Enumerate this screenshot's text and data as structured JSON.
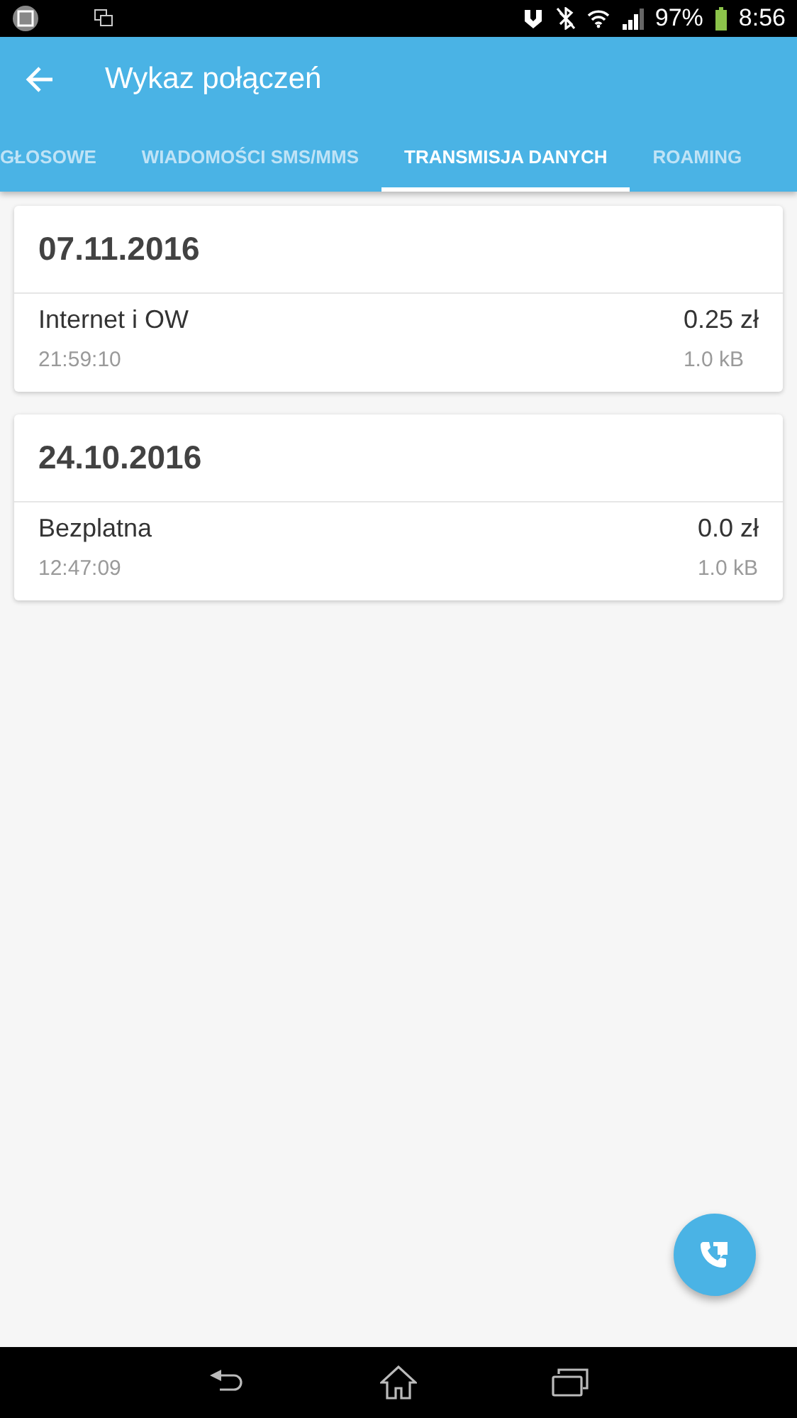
{
  "status_bar": {
    "battery_text": "97%",
    "time": "8:56"
  },
  "app_bar": {
    "title": "Wykaz połączeń"
  },
  "tabs": [
    {
      "label": "GŁOSOWE",
      "selected": false
    },
    {
      "label": "WIADOMOŚCI SMS/MMS",
      "selected": false
    },
    {
      "label": "TRANSMISJA DANYCH",
      "selected": true
    },
    {
      "label": "ROAMING",
      "selected": false
    }
  ],
  "days": [
    {
      "date": "07.11.2016",
      "entries": [
        {
          "name": "Internet i OW",
          "cost": "0.25 zł",
          "time": "21:59:10",
          "size": "1.0 kB"
        }
      ]
    },
    {
      "date": "24.10.2016",
      "entries": [
        {
          "name": "Bezplatna",
          "cost": "0.0 zł",
          "time": "12:47:09",
          "size": "1.0 kB"
        }
      ]
    }
  ]
}
